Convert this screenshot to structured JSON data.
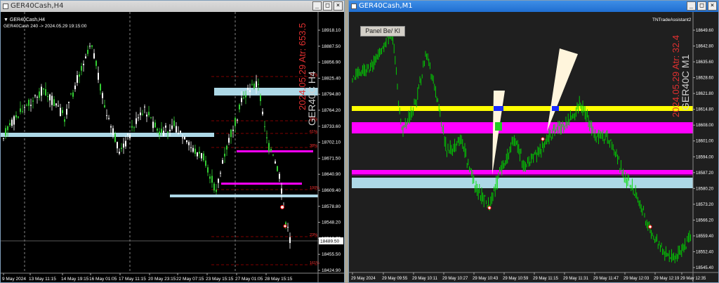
{
  "left": {
    "title": "GER40Cash,H4",
    "symbol_line": "GER40Cash,H4",
    "info_line": "GER40Cash 240 -> 2024.05.29 19:15:00",
    "watermark_symbol": "GER40C H4",
    "watermark_date": "2024.05.29 Atr: 653.5",
    "price_labels": [
      "18918.10",
      "18887.50",
      "18856.90",
      "18825.40",
      "18794.80",
      "18764.20",
      "18733.60",
      "18702.10",
      "18671.50",
      "18640.90",
      "18609.40",
      "18578.80",
      "18548.20",
      "18516.70",
      "18455.50",
      "18424.90"
    ],
    "current_price": "18489.50",
    "time_labels": [
      "9 May 2024",
      "13 May 11:15",
      "14 May 19:15",
      "16 May 01:05",
      "17 May 11:15",
      "20 May 23:15",
      "22 May 07:15",
      "23 May 15:15",
      "27 May 01:05",
      "28 May 15:15"
    ],
    "level_labels": [
      "78%",
      "50%",
      "61%",
      "38%",
      "100%",
      "23%",
      "161%"
    ],
    "colors": {
      "bullish": "#32cd32",
      "bearish": "#ffffff",
      "level_cyan": "#add8e6",
      "level_magenta": "#ff00ff",
      "level_red": "#ff0000"
    }
  },
  "right": {
    "title": "GER40Cash,M1",
    "panel_button": "Panel Be/ Kl",
    "indicator_label": "TNTradeAssistant2",
    "watermark_symbol": "GER40C M1",
    "watermark_date": "2024.05.29 Atr: 32.4",
    "price_labels": [
      "18649.60",
      "18642.80",
      "18635.60",
      "18628.60",
      "18621.80",
      "18614.80",
      "18608.00",
      "18601.00",
      "18594.00",
      "18587.20",
      "18580.20",
      "18573.20",
      "18566.20",
      "18559.40",
      "18552.40",
      "18545.40"
    ],
    "time_labels": [
      "29 May 2024",
      "29 May 09:55",
      "29 May 10:11",
      "29 May 10:27",
      "29 May 10:43",
      "29 May 10:59",
      "29 May 11:15",
      "29 May 11:31",
      "29 May 11:47",
      "29 May 12:03",
      "29 May 12:19",
      "29 May 12:35"
    ],
    "colors": {
      "candles": "#00dd00",
      "yellow_zone": "#ffff00",
      "magenta_zone": "#ff00ff",
      "cyan_zone": "#add8e6"
    }
  },
  "window_buttons": {
    "minimize": "_",
    "maximize": "□",
    "close": "×"
  }
}
